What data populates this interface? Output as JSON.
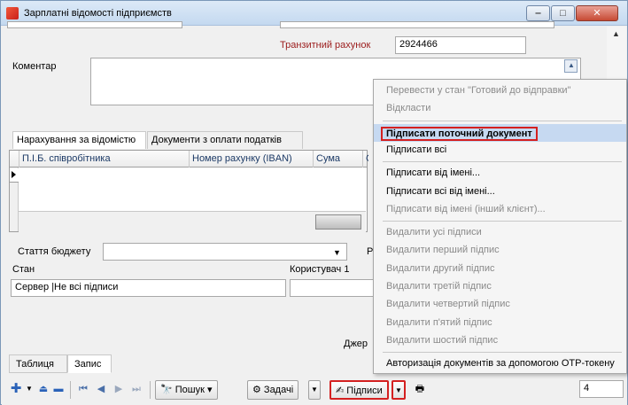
{
  "window": {
    "title": "Зарплатні відомості підприємств"
  },
  "form": {
    "transit_label": "Транзитний рахунок",
    "transit_value": "2924466",
    "comment_label": "Коментар",
    "comment_value": "",
    "tabs": [
      "Нарахування за відомістю",
      "Документи з оплати податків"
    ],
    "grid_columns": [
      "П.І.Б. співробітника",
      "Номер рахунку (IBAN)",
      "Сума",
      "С"
    ],
    "budget_label": "Стаття бюджету",
    "budget_value": "",
    "budget_right_fragment": "Р",
    "state_label": "Стан",
    "state_value": "Сервер |Не всі підписи",
    "user_label": "Користувач 1",
    "source_fragment": "Джер"
  },
  "bottom_tabs": {
    "table": "Таблиця",
    "record": "Запис",
    "active": "record"
  },
  "toolbar": {
    "search": "Пошук",
    "tasks": "Задачі",
    "signatures": "Підписи",
    "record_number": "4"
  },
  "context_menu": {
    "items": [
      {
        "label": "Перевести у стан \"Готовий до відправки\"",
        "enabled": false
      },
      {
        "label": "Відкласти",
        "enabled": false
      },
      {
        "separator": true
      },
      {
        "label": "Підписати поточний документ",
        "enabled": true,
        "highlighted": true
      },
      {
        "label": "Підписати всі",
        "enabled": true
      },
      {
        "separator": true
      },
      {
        "label": "Підписати від імені...",
        "enabled": true
      },
      {
        "label": "Підписати всі від імені...",
        "enabled": true
      },
      {
        "label": "Підписати від імені (інший клієнт)...",
        "enabled": false
      },
      {
        "separator": true
      },
      {
        "label": "Видалити усі підписи",
        "enabled": false
      },
      {
        "label": "Видалити перший підпис",
        "enabled": false
      },
      {
        "label": "Видалити другий підпис",
        "enabled": false
      },
      {
        "label": "Видалити третій підпис",
        "enabled": false
      },
      {
        "label": "Видалити четвертий підпис",
        "enabled": false
      },
      {
        "label": "Видалити п'ятий підпис",
        "enabled": false
      },
      {
        "label": "Видалити шостий підпис",
        "enabled": false
      },
      {
        "separator": true
      },
      {
        "label": "Авторизація документів за допомогою ОТР-токену",
        "enabled": true
      }
    ]
  }
}
